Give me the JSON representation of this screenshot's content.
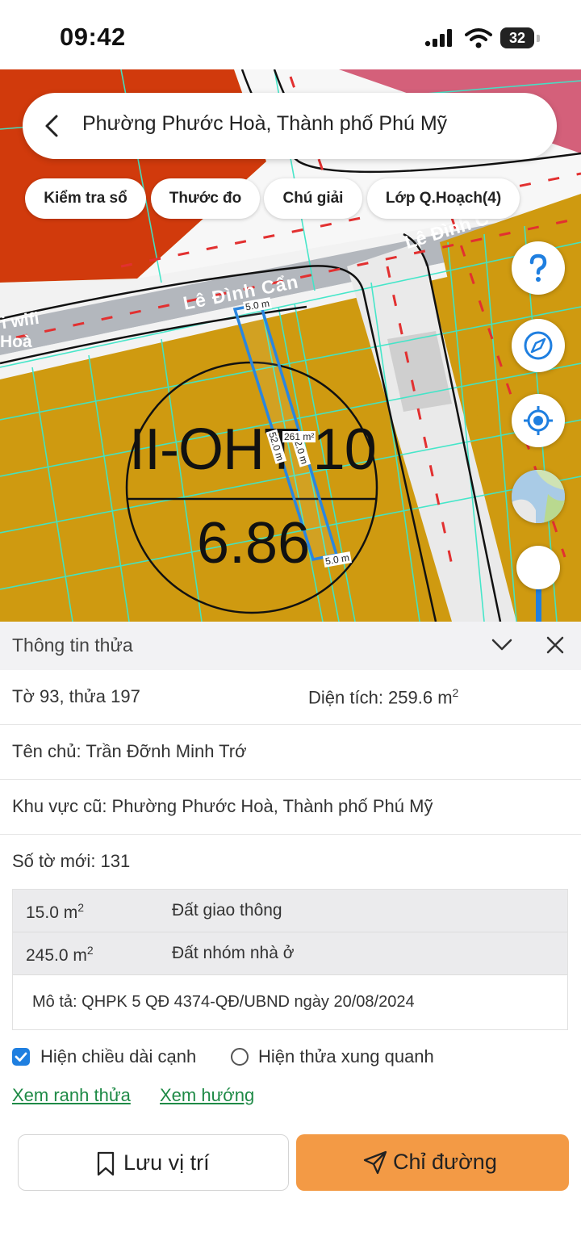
{
  "status_bar": {
    "time": "09:42",
    "battery": "32"
  },
  "search": {
    "title": "Phường Phước Hoà, Thành phố Phú Mỹ"
  },
  "chips": [
    "Kiểm tra sổ",
    "Thước đo",
    "Chú giải",
    "Lớp Q.Hoạch(4)"
  ],
  "map": {
    "street_label": "Lê Đình Cẩn",
    "street_label_2": "Lê Đình C",
    "poi_label_1": "i wifi",
    "poi_label_2": "Hoà",
    "zone_code": "II-OHT 10",
    "zone_value": "6.86",
    "edge_top": "5.0 m",
    "edge_bottom": "5.0 m",
    "edge_side": "52.0 m",
    "edge_side_2": "52.0 m",
    "area_label": "261 m²"
  },
  "panel": {
    "title": "Thông tin thửa",
    "sheet_parcel": "Tờ 93, thửa 197",
    "area_label": "Diện tích: 259.6 m",
    "area_sup": "2",
    "owner": "Tên chủ: Trần Đỡnh Minh Trớ",
    "old_area": "Khu vực cũ: Phường Phước Hoà, Thành phố Phú Mỹ",
    "new_sheet": "Số tờ mới: 131",
    "land_use": [
      {
        "area": "15.0 m",
        "sup": "2",
        "type": "Đất giao thông"
      },
      {
        "area": "245.0 m",
        "sup": "2",
        "type": "Đất nhóm nhà ở"
      }
    ],
    "description": "Mô tả: QHPK 5 QĐ 4374-QĐ/UBND ngày 20/08/2024",
    "option_edges": "Hiện chiều dài cạnh",
    "option_edges_checked": true,
    "option_neighbors": "Hiện thửa xung quanh",
    "option_neighbors_checked": false,
    "link_boundary": "Xem ranh thửa",
    "link_direction": "Xem hướng",
    "save_button": "Lưu vị trí",
    "route_button": "Chỉ đường"
  },
  "colors": {
    "accent_orange": "#f39a45",
    "link_green": "#1e8a46",
    "check_blue": "#1f7fe0",
    "zone_yellow": "#cf9a10",
    "zone_red": "#d13a0c"
  }
}
